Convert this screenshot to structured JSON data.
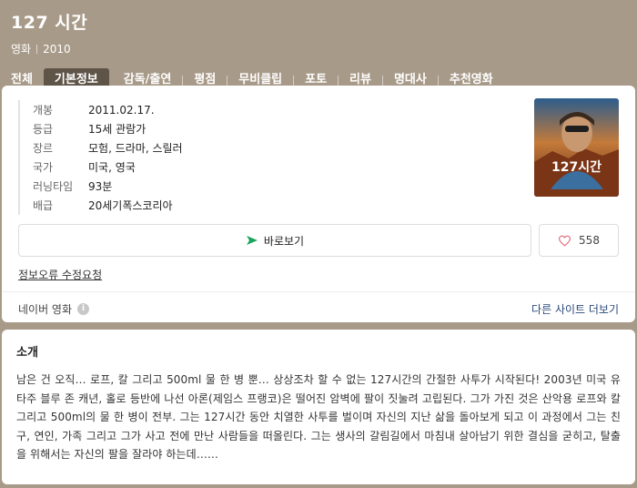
{
  "header": {
    "title": "127 시간",
    "category": "영화",
    "year": "2010"
  },
  "tabs": [
    {
      "label": "전체"
    },
    {
      "label": "기본정보",
      "active": true
    },
    {
      "label": "감독/출연"
    },
    {
      "label": "평점"
    },
    {
      "label": "무비클립"
    },
    {
      "label": "포토"
    },
    {
      "label": "리뷰"
    },
    {
      "label": "명대사"
    },
    {
      "label": "추천영화"
    }
  ],
  "info": {
    "rows": [
      {
        "key": "개봉",
        "value": "2011.02.17."
      },
      {
        "key": "등급",
        "value": "15세 관람가"
      },
      {
        "key": "장르",
        "value": "모험, 드라마, 스릴러"
      },
      {
        "key": "국가",
        "value": "미국, 영국"
      },
      {
        "key": "러닝타임",
        "value": "93분"
      },
      {
        "key": "배급",
        "value": "20세기폭스코리아"
      }
    ],
    "poster_text": "127시간",
    "watch_label": "바로보기",
    "like_count": "558",
    "report_label": "정보오류 수정요청",
    "source_label": "네이버 영화",
    "more_label": "다른 사이트 더보기"
  },
  "intro": {
    "title": "소개",
    "text": "남은 건 오직… 로프, 칼 그리고 500ml 물 한 병 뿐… 상상조차 할 수 없는 127시간의 간절한 사투가 시작된다! 2003년 미국 유타주 블루 존 캐년, 홀로 등반에 나선 아론(제임스 프랭코)은 떨어진 암벽에 팔이 짓눌려 고립된다. 그가 가진 것은 산악용 로프와 칼 그리고 500ml의 물 한 병이 전부. 그는 127시간 동안 치열한 사투를 벌이며 자신의 지난 삶을 돌아보게 되고 이 과정에서 그는 친구, 연인, 가족 그리고 그가 사고 전에 만난 사람들을 떠올린다. 그는 생사의 갈림길에서 마침내 살아남기 위한 결심을 굳히고, 탈출을 위해서는 자신의 팔을 잘라야 하는데……"
  },
  "colors": {
    "header_bg": "#a89a88",
    "active_tab_bg": "#5f5448",
    "link": "#2a4a7a",
    "play_green": "#19a35b",
    "heart": "#e26d7b"
  }
}
